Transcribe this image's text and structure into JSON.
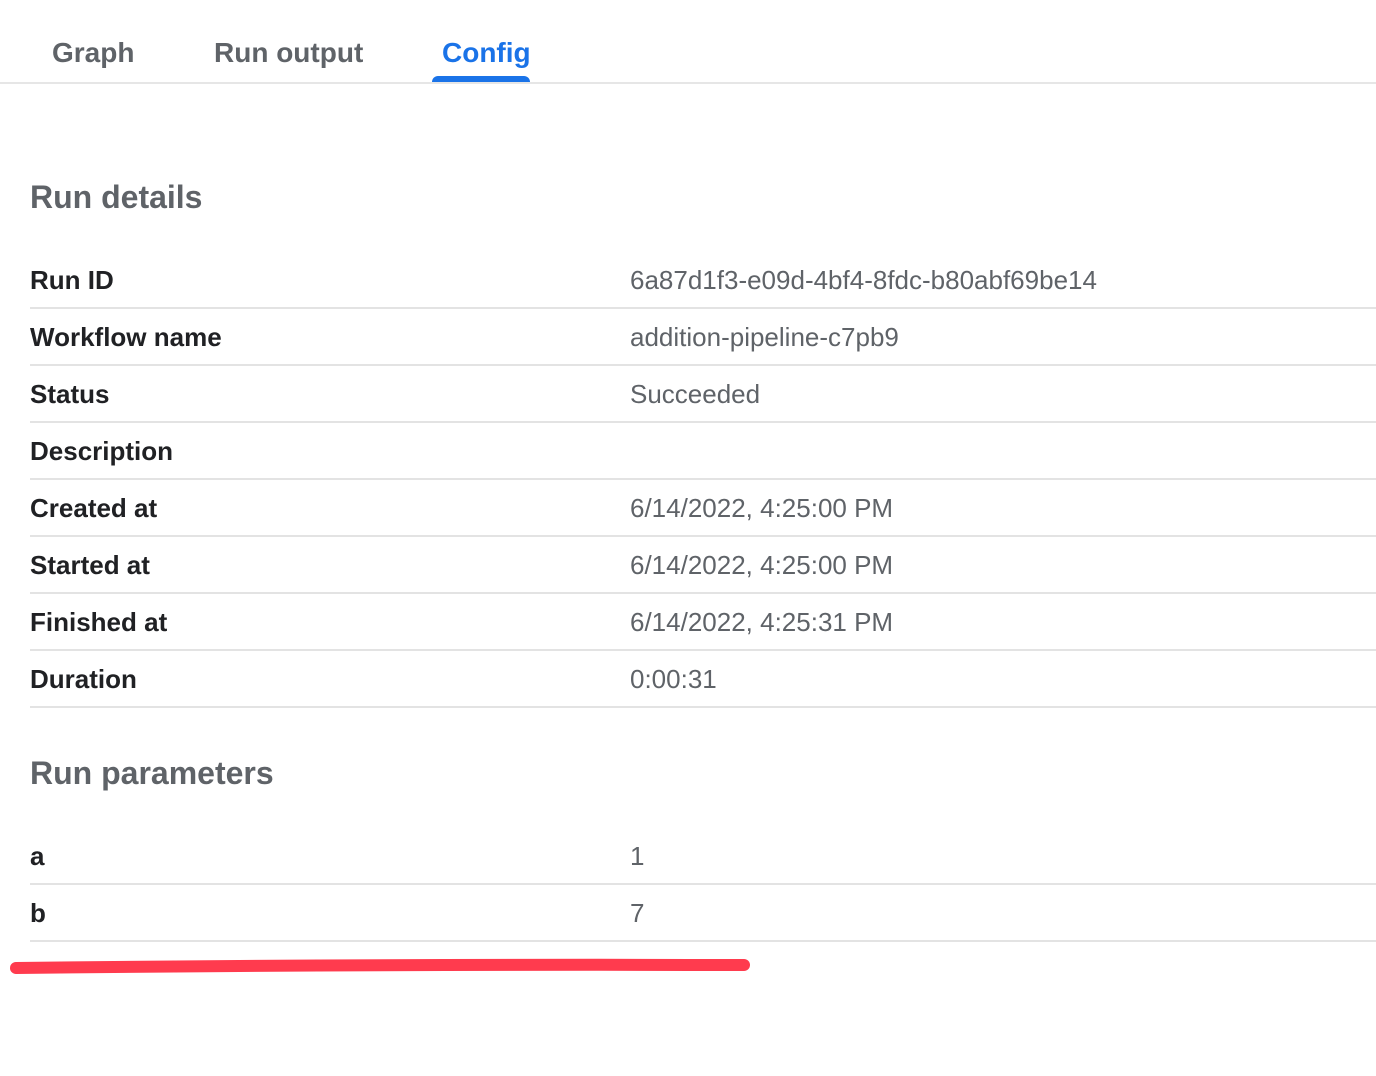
{
  "tabs": [
    {
      "label": "Graph",
      "active": false
    },
    {
      "label": "Run output",
      "active": false
    },
    {
      "label": "Config",
      "active": true
    }
  ],
  "run_details": {
    "title": "Run details",
    "rows": [
      {
        "key": "Run ID",
        "value": "6a87d1f3-e09d-4bf4-8fdc-b80abf69be14"
      },
      {
        "key": "Workflow name",
        "value": "addition-pipeline-c7pb9"
      },
      {
        "key": "Status",
        "value": "Succeeded"
      },
      {
        "key": "Description",
        "value": ""
      },
      {
        "key": "Created at",
        "value": "6/14/2022, 4:25:00 PM"
      },
      {
        "key": "Started at",
        "value": "6/14/2022, 4:25:00 PM"
      },
      {
        "key": "Finished at",
        "value": "6/14/2022, 4:25:31 PM"
      },
      {
        "key": "Duration",
        "value": "0:00:31"
      }
    ]
  },
  "run_parameters": {
    "title": "Run parameters",
    "rows": [
      {
        "key": "a",
        "value": "1"
      },
      {
        "key": "b",
        "value": "7"
      }
    ]
  },
  "colors": {
    "accent": "#1a73e8",
    "annotation": "#ff3b4e"
  }
}
